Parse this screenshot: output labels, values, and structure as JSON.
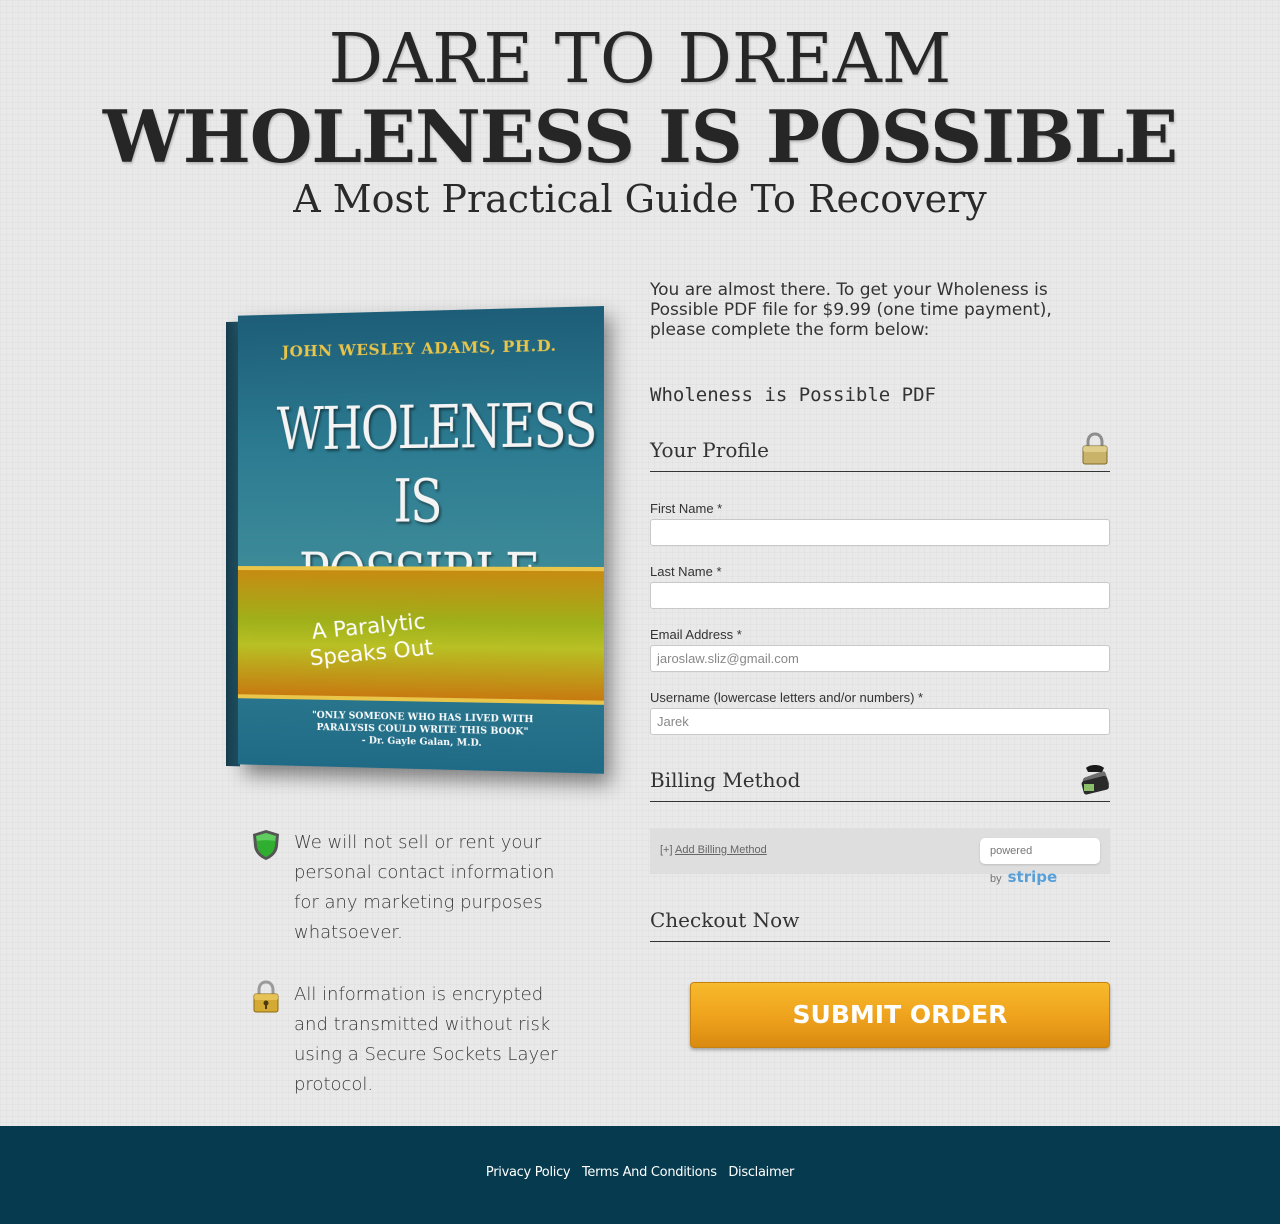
{
  "headline": {
    "line1": "DARE TO DREAM",
    "line2": "WHOLENESS IS POSSIBLE",
    "line3": "A Most Practical Guide To Recovery"
  },
  "book": {
    "author": "JOHN WESLEY ADAMS, PH.D.",
    "title_line1": "WHOLENESS",
    "title_line2": "IS POSSIBLE",
    "subtitle_line1": "A Paralytic",
    "subtitle_line2": "Speaks Out",
    "quote_line1": "\"ONLY SOMEONE WHO HAS LIVED WITH",
    "quote_line2": "PARALYSIS COULD WRITE THIS BOOK\"",
    "quote_attrib": "- Dr. Gayle Galan, M.D."
  },
  "guarantees": {
    "privacy": "We will not sell or rent your personal contact information for any marketing purposes whatsoever.",
    "security": "All information is encrypted and transmitted without risk using a Secure Sockets Layer protocol."
  },
  "form": {
    "intro": "You are almost there. To get your Wholeness is Possible PDF file for $9.99 (one time payment), please complete the form below:",
    "product_name": "Wholeness is Possible PDF",
    "profile_heading": "Your Profile",
    "first_name_label": "First Name *",
    "first_name_value": "",
    "last_name_label": "Last Name *",
    "last_name_value": "",
    "email_label": "Email Address *",
    "email_value": "jaroslaw.sliz@gmail.com",
    "username_label": "Username (lowercase letters and/or numbers) *",
    "username_value": "Jarek",
    "billing_heading": "Billing Method",
    "billing_prefix": "[+]",
    "billing_link": "Add Billing Method",
    "stripe_powered": "powered by",
    "stripe_brand": "stripe",
    "checkout_heading": "Checkout Now",
    "submit_label": "SUBMIT ORDER"
  },
  "footer": {
    "privacy": "Privacy Policy",
    "terms": "Terms And Conditions",
    "disclaimer": "Disclaimer"
  },
  "icons": {
    "shield": "shield-icon",
    "lock": "padlock-icon",
    "wallet": "wallet-icon"
  },
  "colors": {
    "submit": "#eea11c",
    "footer_bg": "#053a4f",
    "stripe": "#5aa0d8"
  }
}
